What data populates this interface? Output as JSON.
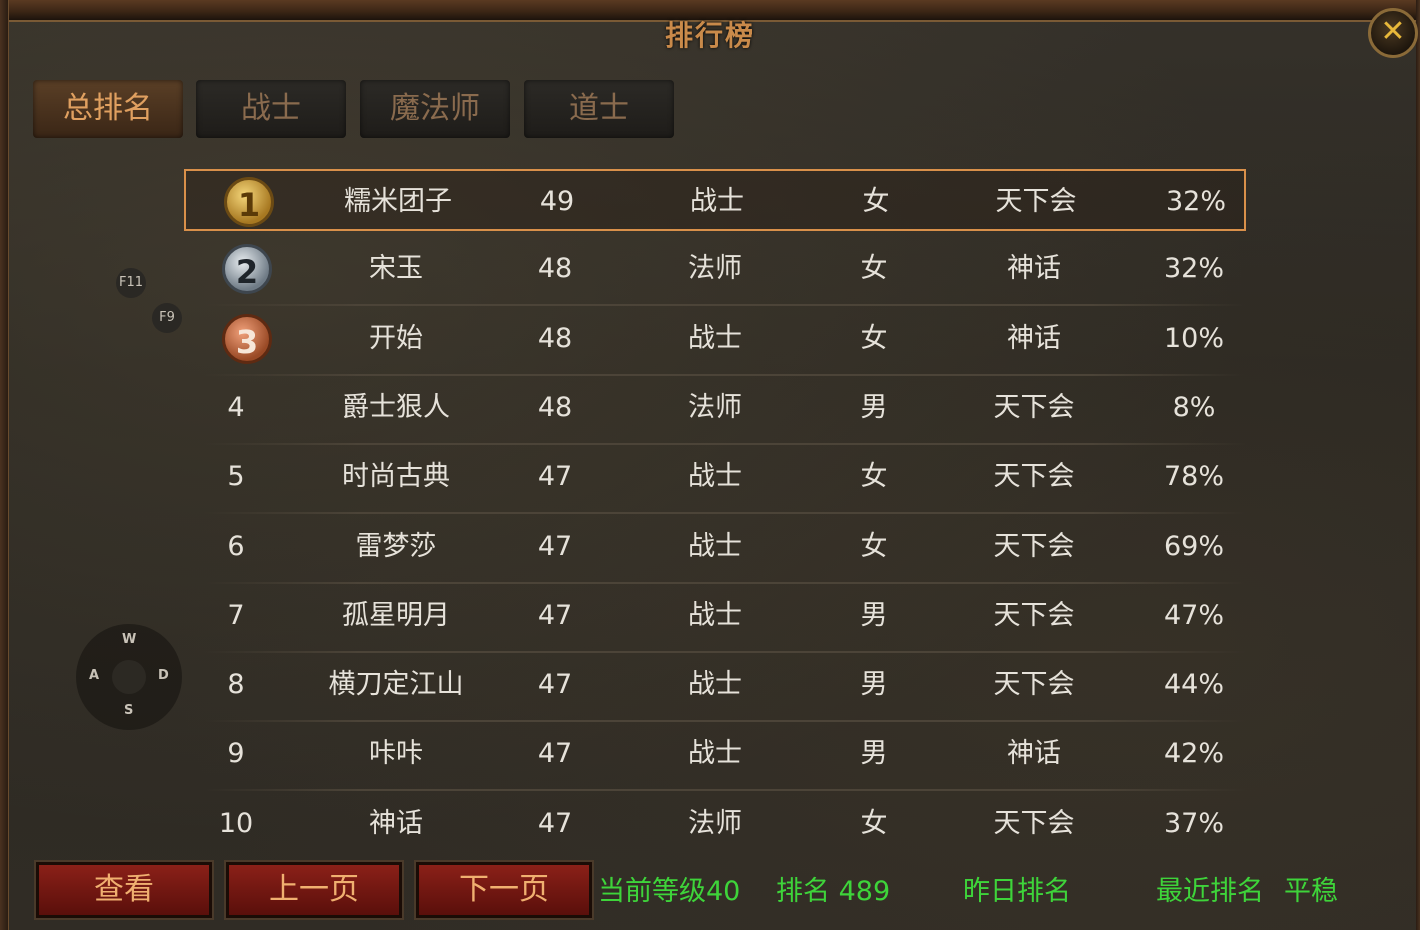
{
  "window": {
    "title": "排行榜",
    "close_icon": "close-icon"
  },
  "tabs": [
    {
      "label": "总排名",
      "active": true
    },
    {
      "label": "战士",
      "active": false
    },
    {
      "label": "魔法师",
      "active": false
    },
    {
      "label": "道士",
      "active": false
    }
  ],
  "rankings": [
    {
      "rank": "1",
      "medal": "gold",
      "name": "糯米团子",
      "level": "49",
      "class": "战士",
      "gender": "女",
      "guild": "天下会",
      "percent": "32%"
    },
    {
      "rank": "2",
      "medal": "silver",
      "name": "宋玉",
      "level": "48",
      "class": "法师",
      "gender": "女",
      "guild": "神话",
      "percent": "32%"
    },
    {
      "rank": "3",
      "medal": "bronze",
      "name": "开始",
      "level": "48",
      "class": "战士",
      "gender": "女",
      "guild": "神话",
      "percent": "10%"
    },
    {
      "rank": "4",
      "name": "爵士狠人",
      "level": "48",
      "class": "法师",
      "gender": "男",
      "guild": "天下会",
      "percent": "8%"
    },
    {
      "rank": "5",
      "name": "时尚古典",
      "level": "47",
      "class": "战士",
      "gender": "女",
      "guild": "天下会",
      "percent": "78%"
    },
    {
      "rank": "6",
      "name": "雷梦莎",
      "level": "47",
      "class": "战士",
      "gender": "女",
      "guild": "天下会",
      "percent": "69%"
    },
    {
      "rank": "7",
      "name": "孤星明月",
      "level": "47",
      "class": "战士",
      "gender": "男",
      "guild": "天下会",
      "percent": "47%"
    },
    {
      "rank": "8",
      "name": "横刀定江山",
      "level": "47",
      "class": "战士",
      "gender": "男",
      "guild": "天下会",
      "percent": "44%"
    },
    {
      "rank": "9",
      "name": "咔咔",
      "level": "47",
      "class": "战士",
      "gender": "男",
      "guild": "神话",
      "percent": "42%"
    },
    {
      "rank": "10",
      "name": "神话",
      "level": "47",
      "class": "法师",
      "gender": "女",
      "guild": "天下会",
      "percent": "37%"
    }
  ],
  "overlay": {
    "hotkey_f11": "F11",
    "hotkey_f9": "F9",
    "joystick": {
      "up": "W",
      "left": "A",
      "right": "D",
      "down": "S"
    }
  },
  "buttons": {
    "view": "查看",
    "prev_page": "上一页",
    "next_page": "下一页"
  },
  "status": {
    "current_level": "当前等级40",
    "rank": "排名 489",
    "yesterday_rank": "昨日排名",
    "recent_rank": "最近排名",
    "trend": "平稳"
  },
  "colors": {
    "title": "#c98a4a",
    "status_text": "#3ed43a",
    "highlight_border": "#d9904a",
    "button_bg": "#8a2018",
    "tab_active_text": "#e0a060"
  }
}
